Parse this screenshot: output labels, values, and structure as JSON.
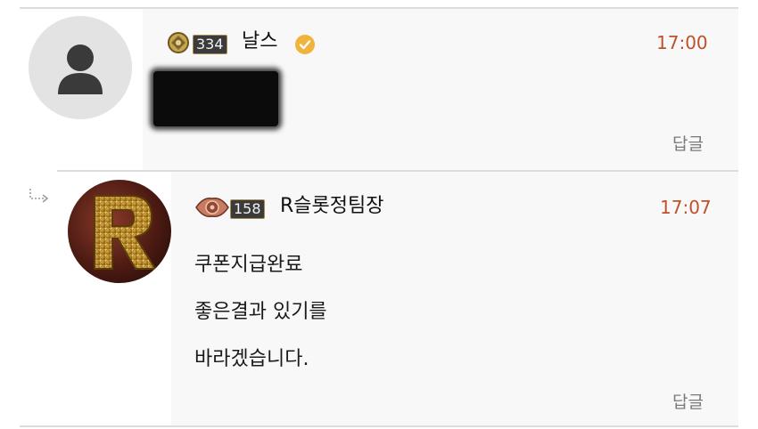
{
  "comments": [
    {
      "user": {
        "name": "날스",
        "level": "334",
        "verified": true
      },
      "time": "17:00",
      "reply_label": "답글"
    },
    {
      "user": {
        "name": "R슬롯정팀장",
        "level": "158",
        "verified": false
      },
      "time": "17:07",
      "message_lines": [
        "쿠폰지급완료",
        "좋은결과 있기를",
        "바라겠습니다."
      ],
      "reply_label": "답글"
    }
  ],
  "colors": {
    "timestamp": "#c0502a",
    "verified_badge": "#f0b43c",
    "reply_text": "#7a7a7a",
    "divider": "#dcdcdc",
    "avatar_placeholder": "#e3e3e3"
  },
  "icons": [
    "user-silhouette-icon",
    "level-badge-icon",
    "verified-icon",
    "reply-arrow-icon"
  ]
}
